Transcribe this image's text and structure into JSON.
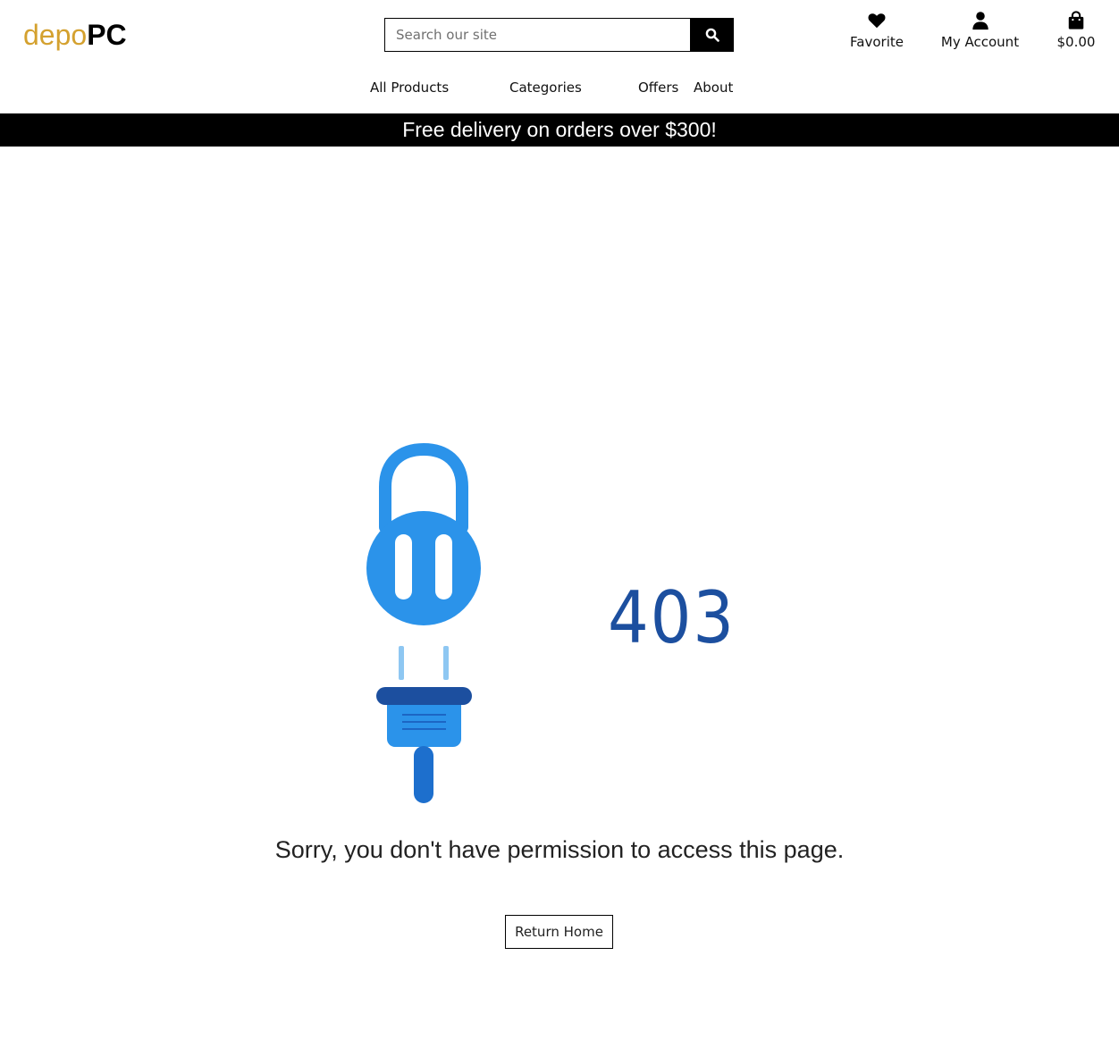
{
  "brand": {
    "part1": "depo",
    "part2": "PC",
    "color_part1": "#d4a12f"
  },
  "search": {
    "placeholder": "Search our site",
    "button_icon": "search-icon"
  },
  "toolbar": {
    "favorite_label": "Favorite",
    "account_label": "My Account",
    "cart_total": "$0.00"
  },
  "nav": {
    "items": [
      {
        "label": "All Products"
      },
      {
        "label": "Categories"
      },
      {
        "label": "Offers"
      },
      {
        "label": "About"
      }
    ]
  },
  "banner": {
    "text": "Free delivery on orders over $300!"
  },
  "error": {
    "code": "403",
    "message": "Sorry, you don't have permission to access this page.",
    "return_label": "Return Home",
    "illustration_icon": "padlock-plug-icon"
  },
  "colors": {
    "accent_blue": "#2b93ea",
    "dark_blue": "#1c4f9f",
    "banner_bg": "#000000"
  }
}
